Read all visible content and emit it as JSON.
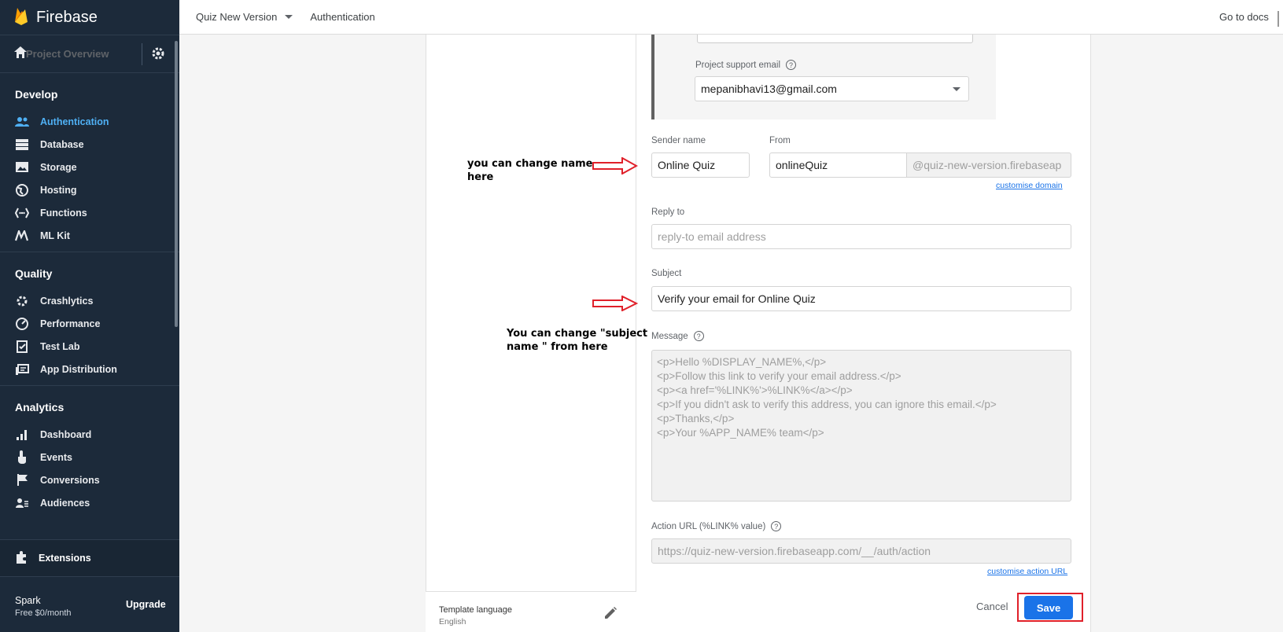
{
  "sidebar": {
    "brand": "Firebase",
    "overview": "Project Overview",
    "sections": [
      {
        "title": "Develop",
        "items": [
          {
            "label": "Authentication",
            "icon": "people-icon",
            "active": true
          },
          {
            "label": "Database",
            "icon": "database-icon"
          },
          {
            "label": "Storage",
            "icon": "image-icon"
          },
          {
            "label": "Hosting",
            "icon": "globe-icon"
          },
          {
            "label": "Functions",
            "icon": "functions-icon"
          },
          {
            "label": "ML Kit",
            "icon": "ml-kit-icon"
          }
        ]
      },
      {
        "title": "Quality",
        "items": [
          {
            "label": "Crashlytics",
            "icon": "gear-bug-icon"
          },
          {
            "label": "Performance",
            "icon": "speed-icon"
          },
          {
            "label": "Test Lab",
            "icon": "checklist-icon"
          },
          {
            "label": "App Distribution",
            "icon": "distribution-icon"
          }
        ]
      },
      {
        "title": "Analytics",
        "items": [
          {
            "label": "Dashboard",
            "icon": "bar-chart-icon"
          },
          {
            "label": "Events",
            "icon": "touch-icon"
          },
          {
            "label": "Conversions",
            "icon": "flag-icon"
          },
          {
            "label": "Audiences",
            "icon": "audience-icon"
          }
        ]
      }
    ],
    "extensions": "Extensions",
    "plan": {
      "name": "Spark",
      "price": "Free $0/month",
      "upgrade": "Upgrade"
    }
  },
  "topbar": {
    "project": "Quiz New Version",
    "section": "Authentication",
    "docs": "Go to docs"
  },
  "form": {
    "support_email_label": "Project support email",
    "support_email_value": "mepanibhavi13@gmail.com",
    "sender_name_label": "Sender name",
    "sender_name_value": "Online Quiz",
    "from_label": "From",
    "from_value": "onlineQuiz",
    "from_domain": "@quiz-new-version.firebaseap",
    "customise_domain": "customise domain",
    "reply_to_label": "Reply to",
    "reply_to_placeholder": "reply-to email address",
    "subject_label": "Subject",
    "subject_value": "Verify your email for Online Quiz",
    "message_label": "Message",
    "message_lines": [
      "<p>Hello %DISPLAY_NAME%,</p>",
      "<p>Follow this link to verify your email address.</p>",
      "<p><a href='%LINK%'>%LINK%</a></p>",
      "<p>If you didn't ask to verify this address, you can ignore this email.</p>",
      "<p>Thanks,</p>",
      "<p>Your %APP_NAME% team</p>"
    ],
    "action_url_label": "Action URL (%LINK% value)",
    "action_url_value": "https://quiz-new-version.firebaseapp.com/__/auth/action",
    "customise_action_url": "customise action URL",
    "cancel": "Cancel",
    "save": "Save"
  },
  "template_language": {
    "label": "Template language",
    "value": "English"
  },
  "annotations": {
    "name_line1": "you can change name",
    "name_line2": "here",
    "subject_line1": "You can change \"subject",
    "subject_line2": "name \" from here"
  },
  "colors": {
    "sidebar": "#1c2a3a",
    "accent": "#1a73e8",
    "active_nav": "#4fb0f4",
    "highlight": "#e0202a"
  }
}
